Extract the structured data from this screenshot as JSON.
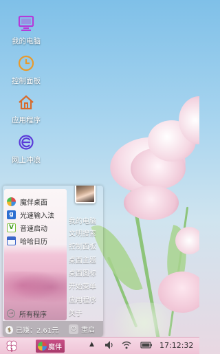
{
  "desktop": {
    "icons": [
      {
        "label": "我的电脑",
        "icon": "computer-icon",
        "color": "#b43bd9"
      },
      {
        "label": "控制面板",
        "icon": "clock-icon",
        "color": "#e89a2c"
      },
      {
        "label": "应用程序",
        "icon": "home-icon",
        "color": "#d96a2a"
      },
      {
        "label": "网上冲浪",
        "icon": "ie-browser-icon",
        "color": "#5b3bd9"
      }
    ]
  },
  "start_menu": {
    "apps": [
      {
        "label": "魔伴桌面",
        "icon": "pinwheel-icon"
      },
      {
        "label": "光速输入法",
        "icon": "input-method-icon"
      },
      {
        "label": "音速启动",
        "icon": "launcher-v-icon"
      },
      {
        "label": "哈哈日历",
        "icon": "calendar-icon"
      }
    ],
    "all_programs": "所有程序",
    "right_items": [
      "我的电脑",
      "文明搜索",
      "控制面板",
      "桌面主题",
      "桌面图标",
      "开始菜单",
      "应用程序",
      "关于"
    ],
    "used_label": "已赚：2.61元",
    "restart_label": "重启"
  },
  "taskbar": {
    "task_label": "魔伴",
    "time": "17:12:32"
  },
  "colors": {
    "taskbar_bg": "#efc3d6",
    "task_active": "#b8457a"
  }
}
